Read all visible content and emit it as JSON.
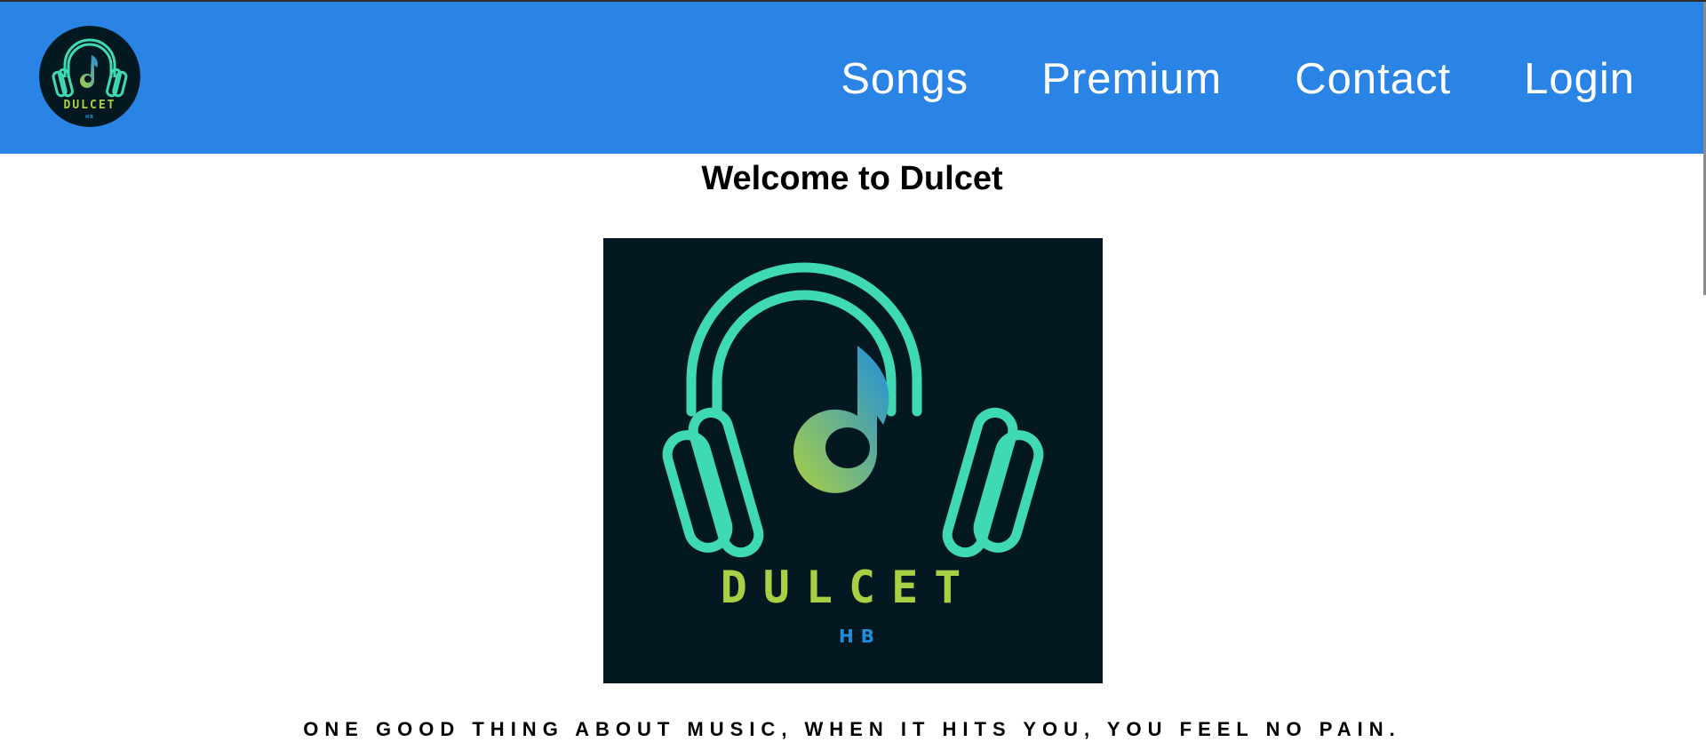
{
  "brand": {
    "logo_wordmark": "DULCET",
    "logo_subtext": "HB",
    "colors": {
      "nav_bg": "#2a84e6",
      "logo_bg": "#041821",
      "teal": "#3fd9b4",
      "green": "#a9cf45",
      "blue": "#1f8fdc"
    }
  },
  "nav": {
    "logo_icon": "headphones-music-note-icon",
    "links": [
      {
        "label": "Songs"
      },
      {
        "label": "Premium"
      },
      {
        "label": "Contact"
      },
      {
        "label": "Login"
      }
    ]
  },
  "main": {
    "title": "Welcome to Dulcet",
    "hero_icon": "headphones-music-note-icon",
    "tagline": "ONE GOOD THING ABOUT MUSIC, WHEN IT HITS YOU, YOU FEEL NO PAIN."
  }
}
